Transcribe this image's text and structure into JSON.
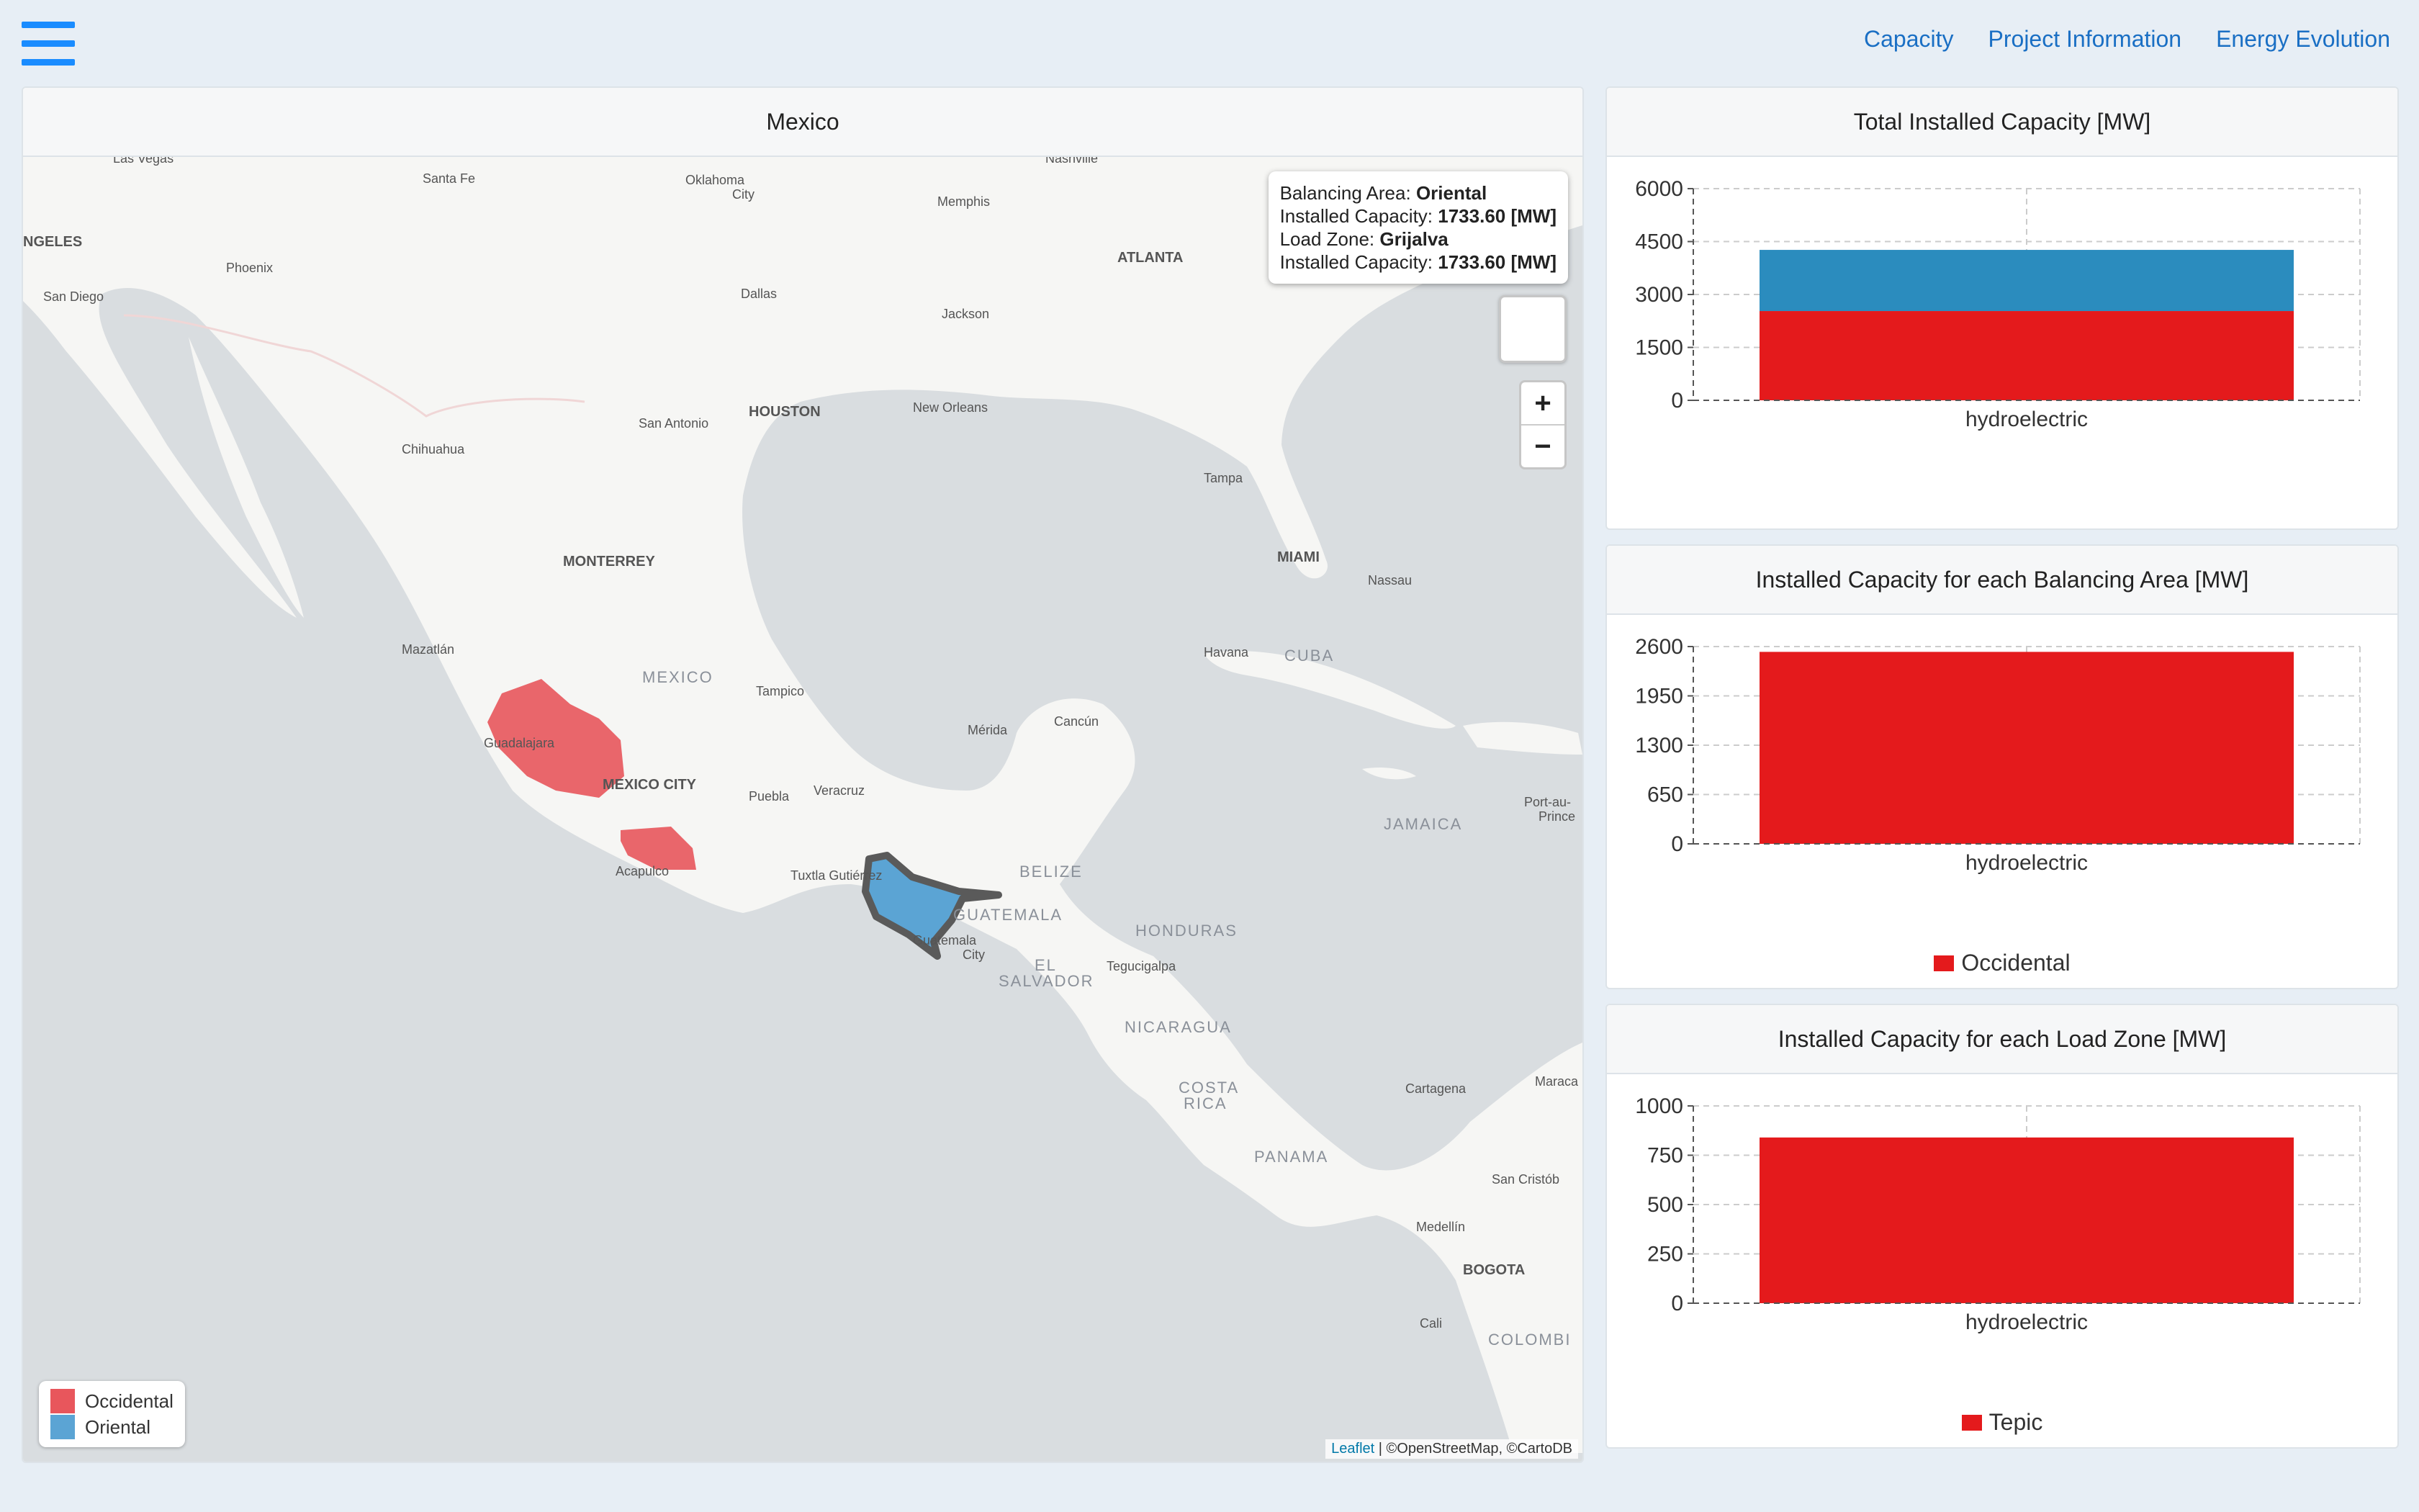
{
  "nav": {
    "capacity": "Capacity",
    "project_information": "Project Information",
    "energy_evolution": "Energy Evolution"
  },
  "map": {
    "title": "Mexico",
    "tooltip": {
      "balancing_area_label": "Balancing Area:",
      "balancing_area": "Oriental",
      "installed_capacity_label": "Installed Capacity:",
      "installed_capacity": "1733.60 [MW]",
      "load_zone_label": "Load Zone:",
      "load_zone": "Grijalva",
      "installed_capacity_label2": "Installed Capacity:",
      "installed_capacity2": "1733.60 [MW]"
    },
    "zoom_in": "+",
    "zoom_out": "−",
    "legend": [
      {
        "label": "Occidental",
        "color": "#e8565c"
      },
      {
        "label": "Oriental",
        "color": "#5ba4d4"
      }
    ],
    "attribution": {
      "leaflet": "Leaflet",
      "rest": " | ©OpenStreetMap, ©CartoDB"
    },
    "places": {
      "las_vegas": "Las Vegas",
      "santa_fe": "Santa Fe",
      "oklahoma": "Oklahoma",
      "oklahoma_city": "City",
      "nashville": "Nashville",
      "angeles": "NGELES",
      "phoenix": "Phoenix",
      "memphis": "Memphis",
      "atlanta": "ATLANTA",
      "san_diego": "San Diego",
      "dallas": "Dallas",
      "jackson": "Jackson",
      "san_antonio": "San Antonio",
      "houston": "HOUSTON",
      "new_orleans": "New Orleans",
      "chihuahua": "Chihuahua",
      "tampa": "Tampa",
      "monterrey": "MONTERREY",
      "miami": "MIAMI",
      "nassau": "Nassau",
      "mazatlan": "Mazatlán",
      "havana": "Havana",
      "cuba": "CUBA",
      "mexico": "MEXICO",
      "tampico": "Tampico",
      "merida": "Mérida",
      "cancun": "Cancún",
      "guadalajara": "Guadalajara",
      "mexico_city": "MEXICO CITY",
      "puebla": "Puebla",
      "veracruz": "Veracruz",
      "jamaica": "JAMAICA",
      "port_au": "Port-au-",
      "prince": "Prince",
      "belize": "BELIZE",
      "acapulco": "Acapulco",
      "tuxtla": "Tuxtla Gutiérrez",
      "guatemala": "GUATEMALA",
      "honduras": "HONDURAS",
      "guatemala_city": "Guatemala",
      "guatemala_city2": "City",
      "el": "EL",
      "salvador": "SALVADOR",
      "tegucigalpa": "Tegucigalpa",
      "nicaragua": "NICARAGUA",
      "cartagena": "Cartagena",
      "maracaibo": "Maraca",
      "costa": "COSTA",
      "rica": "RICA",
      "panama": "PANAMA",
      "san_cristobal": "San Cristób",
      "medellin": "Medellín",
      "bogota": "BOGOTA",
      "cali": "Cali",
      "colombia": "COLOMBI"
    }
  },
  "charts": [
    {
      "title": "Total Installed Capacity [MW]",
      "chart_data": {
        "type": "bar",
        "stacked": true,
        "categories": [
          "hydroelectric"
        ],
        "series": [
          {
            "values": [
              2530
            ],
            "color": "#e41a1c"
          },
          {
            "values": [
              1734
            ],
            "color": "#2b8cbe"
          }
        ],
        "ylim": [
          0,
          6000
        ],
        "yticks": [
          0,
          1500,
          3000,
          4500,
          6000
        ],
        "legend": []
      }
    },
    {
      "title": "Installed Capacity for each Balancing Area [MW]",
      "chart_data": {
        "type": "bar",
        "categories": [
          "hydroelectric"
        ],
        "series": [
          {
            "name": "Occidental",
            "values": [
              2530
            ],
            "color": "#e41a1c"
          }
        ],
        "ylim": [
          0,
          2600
        ],
        "yticks": [
          0,
          650,
          1300,
          1950,
          2600
        ],
        "legend": [
          {
            "label": "Occidental",
            "color": "#e41a1c"
          }
        ]
      }
    },
    {
      "title": "Installed Capacity for each Load Zone [MW]",
      "chart_data": {
        "type": "bar",
        "categories": [
          "hydroelectric"
        ],
        "series": [
          {
            "name": "Tepic",
            "values": [
              840
            ],
            "color": "#e41a1c"
          }
        ],
        "ylim": [
          0,
          1000
        ],
        "yticks": [
          0,
          250,
          500,
          750,
          1000
        ],
        "legend": [
          {
            "label": "Tepic",
            "color": "#e41a1c"
          }
        ]
      }
    }
  ]
}
